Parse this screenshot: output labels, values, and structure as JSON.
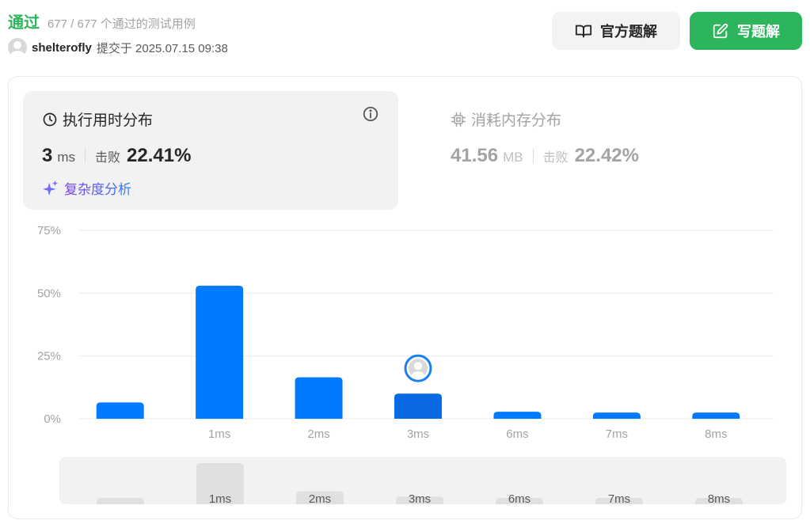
{
  "header": {
    "status": "通过",
    "passed_text": "677 / 677 个通过的测试用例",
    "username": "shelterofly",
    "submitted_text": "提交于 2025.07.15 09:38"
  },
  "buttons": {
    "official": "官方题解",
    "write": "写题解"
  },
  "runtime": {
    "title": "执行用时分布",
    "value": "3",
    "unit": "ms",
    "beat_label": "击败",
    "beat_value": "22.41%",
    "complexity_link": "复杂度分析"
  },
  "memory": {
    "title": "消耗内存分布",
    "value": "41.56",
    "unit": "MB",
    "beat_label": "击败",
    "beat_value": "22.42%"
  },
  "colors": {
    "accent_green": "#2db55d",
    "bar_blue": "#007aff",
    "bar_selected": "#0a6ae3"
  },
  "chart_data": {
    "type": "bar",
    "categories": [
      "",
      "1ms",
      "2ms",
      "3ms",
      "6ms",
      "7ms",
      "8ms"
    ],
    "values": [
      6.5,
      53.0,
      16.5,
      10.0,
      2.8,
      2.5,
      2.5
    ],
    "selected_category": "3ms",
    "ylim": [
      0,
      75
    ],
    "yticks": [
      "0%",
      "25%",
      "50%",
      "75%"
    ],
    "ytick_values": [
      0,
      25,
      50,
      75
    ],
    "grid": true,
    "scrubber_labels": [
      "",
      "1ms",
      "2ms",
      "3ms",
      "6ms",
      "7ms",
      "8ms"
    ]
  }
}
